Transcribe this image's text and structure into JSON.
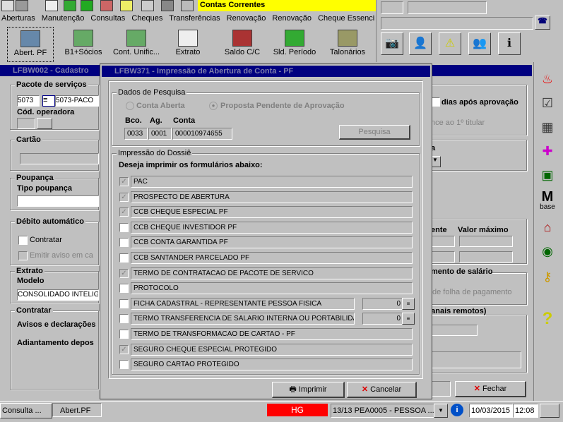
{
  "window_title": "Contas Correntes",
  "menu": [
    "Aberturas",
    "Manutenção",
    "Consultas",
    "Cheques",
    "Transferências",
    "Renovação",
    "Renovação",
    "Cheque Essencia"
  ],
  "toolbar": [
    "Abert. PF",
    "B1+Sócios",
    "Cont. Unific...",
    "Extrato",
    "Saldo C/C",
    "Sld. Período",
    "Talonários"
  ],
  "bg_window": {
    "title": "LFBW002 - Cadastro",
    "pacote_label": "Pacote de serviços",
    "pacote_code": "5073",
    "pacote_desc": "5073-PACO",
    "cod_operadora": "Cód. operadora",
    "cartao": "Cartão",
    "poupanca": "Poupança",
    "tipo_poupanca": "Tipo poupança",
    "debito": "Débito automático",
    "contratar": "Contratar",
    "emitir_aviso": "Emitir aviso em ca",
    "extrato": "Extrato",
    "modelo": "Modelo",
    "modelo_val": "CONSOLIDADO INTELIG",
    "contratar2": "Contratar",
    "avisos": "Avisos e declarações",
    "adiantamento": "Adiantamento depos",
    "dias_aprov": "dias após aprovação",
    "nce_titular": "nce ao 1º titular",
    "ente": "ente",
    "valor_max": "Valor máximo",
    "mento_salario": "mento de salário",
    "folha": "de folha de pagamento",
    "canais": "canais remotos)",
    "fechar": "Fechar",
    "a_letter": "a"
  },
  "dialog": {
    "title": "LFBW371 - Impressão de Abertura de Conta - PF",
    "dados_pesquisa": "Dados de Pesquisa",
    "radio_conta_aberta": "Conta Aberta",
    "radio_proposta": "Proposta Pendente de Aprovação",
    "bco_label": "Bco.",
    "ag_label": "Ag.",
    "conta_label": "Conta",
    "bco": "0033",
    "ag": "0001",
    "conta": "000010974655",
    "pesquisa_btn": "Pesquisa",
    "impressao_title": "Impressão do Dossiê",
    "deseja": "Deseja imprimir os formulários abaixo:",
    "forms": [
      {
        "label": "PAC",
        "checked": true,
        "enabled": false
      },
      {
        "label": "PROSPECTO DE ABERTURA",
        "checked": true,
        "enabled": false
      },
      {
        "label": "CCB CHEQUE ESPECIAL PF",
        "checked": true,
        "enabled": false
      },
      {
        "label": "CCB CHEQUE INVESTIDOR PF",
        "checked": false,
        "enabled": true
      },
      {
        "label": "CCB CONTA GARANTIDA PF",
        "checked": false,
        "enabled": true
      },
      {
        "label": "CCB SANTANDER PARCELADO PF",
        "checked": false,
        "enabled": true
      },
      {
        "label": "TERMO DE CONTRATACAO DE PACOTE DE SERVICO",
        "checked": true,
        "enabled": false
      },
      {
        "label": "PROTOCOLO",
        "checked": false,
        "enabled": true
      },
      {
        "label": "FICHA CADASTRAL - REPRESENTANTE PESSOA FISICA",
        "checked": false,
        "enabled": true,
        "count": "0"
      },
      {
        "label": "TERMO TRANSFERENCIA DE SALARIO INTERNA OU PORTABILIDADE",
        "checked": false,
        "enabled": true,
        "count": "0"
      },
      {
        "label": "TERMO DE TRANSFORMACAO DE CARTAO - PF",
        "checked": false,
        "enabled": true
      },
      {
        "label": "SEGURO CHEQUE ESPECIAL PROTEGIDO",
        "checked": true,
        "enabled": false
      },
      {
        "label": "SEGURO CARTAO PROTEGIDO",
        "checked": false,
        "enabled": true
      }
    ],
    "imprimir": "Imprimir",
    "cancelar": "Cancelar"
  },
  "right_icons": [
    "santander-icon",
    "checklist-icon",
    "calculator-icon",
    "puzzle-icon",
    "monitor-icon",
    "mbase-icon",
    "bank-icon",
    "globe-icon",
    "key-icon",
    "help-icon"
  ],
  "mbase_m": "M",
  "mbase_text": "base",
  "taskbar": {
    "consulta": "Consulta ...",
    "abert": "Abert.PF",
    "hg": "HG",
    "status": "13/13 PEA0005 - PESSOA ...",
    "date": "10/03/2015",
    "time": "12:08"
  },
  "colors": {
    "titlebar": "#000080",
    "hg_bg": "#ff0000",
    "window_title_bg": "#ffff00"
  }
}
